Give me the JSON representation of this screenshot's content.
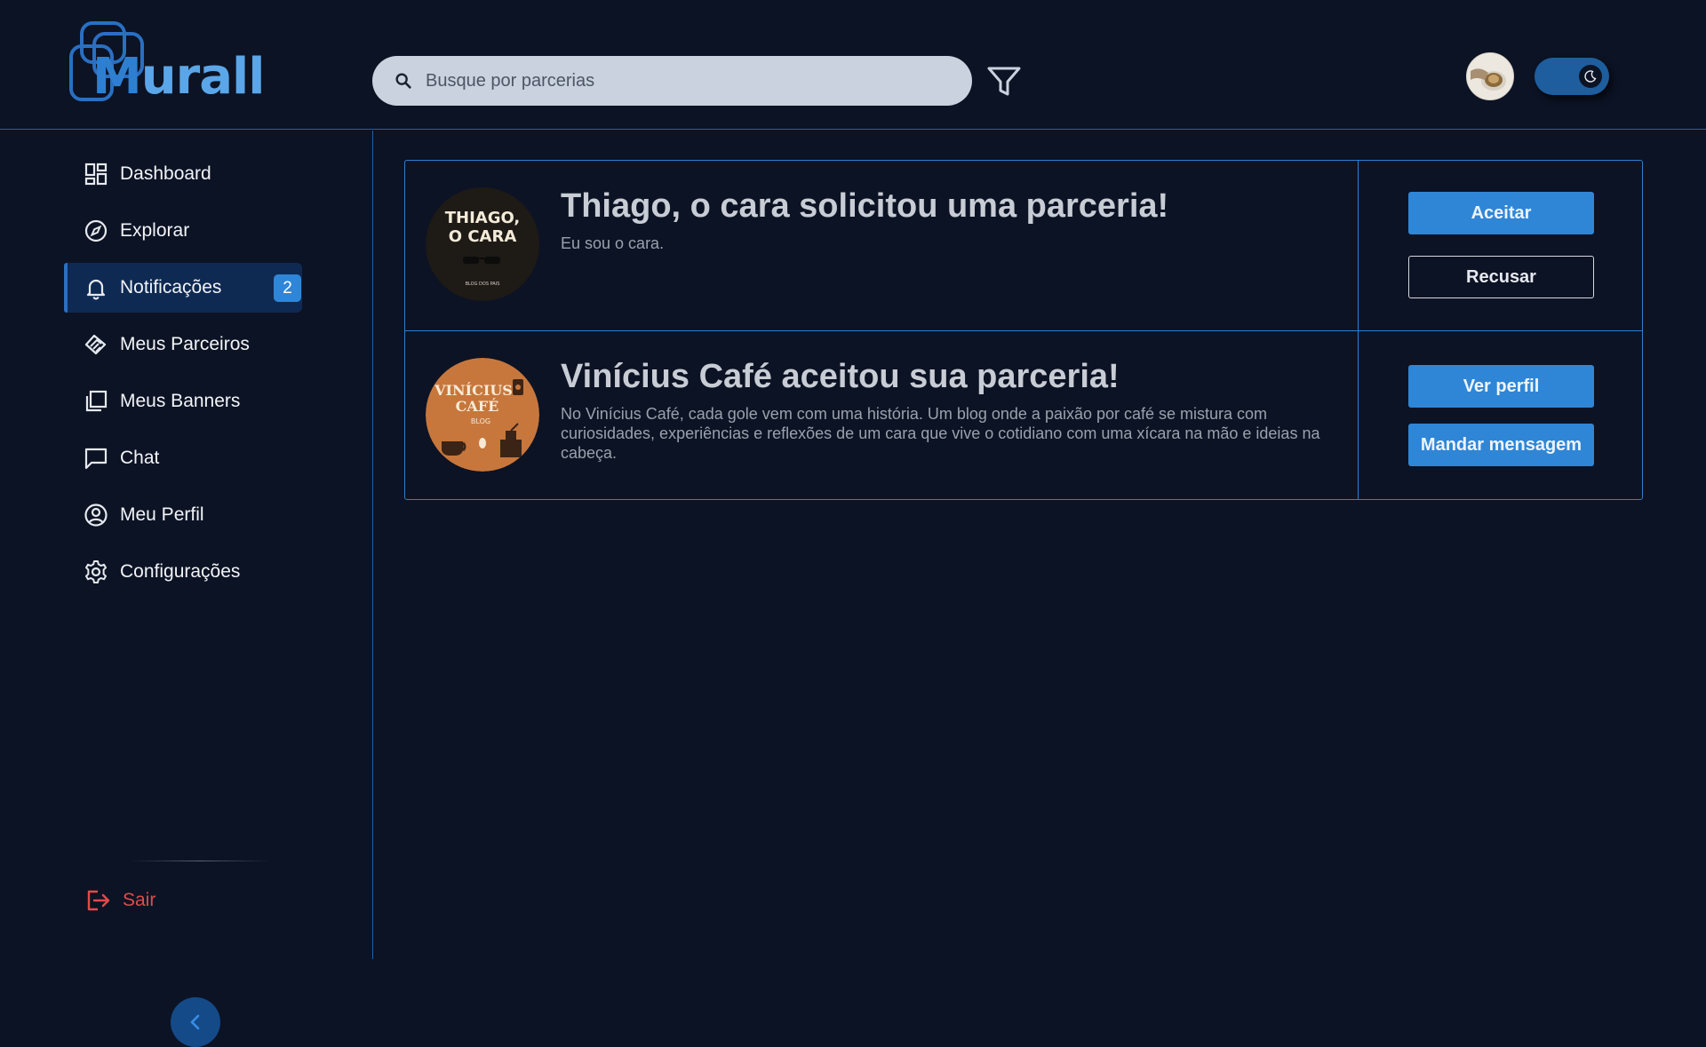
{
  "header": {
    "logo": {
      "text_m": "M",
      "text_rest": "urall"
    },
    "search": {
      "placeholder": "Busque por parcerias"
    },
    "icons": {
      "search": "search-icon",
      "filter": "filter-icon",
      "theme": "moon-icon"
    }
  },
  "sidebar": {
    "items": [
      {
        "label": "Dashboard",
        "icon": "dashboard-icon"
      },
      {
        "label": "Explorar",
        "icon": "compass-icon"
      },
      {
        "label": "Notificações",
        "icon": "bell-icon",
        "badge": "2",
        "active": true
      },
      {
        "label": "Meus Parceiros",
        "icon": "handshake-icon"
      },
      {
        "label": "Meus Banners",
        "icon": "banners-icon"
      },
      {
        "label": "Chat",
        "icon": "chat-icon"
      },
      {
        "label": "Meu Perfil",
        "icon": "user-circle-icon"
      },
      {
        "label": "Configurações",
        "icon": "gear-icon"
      }
    ],
    "logout_label": "Sair"
  },
  "notifications": [
    {
      "title": "Thiago, o cara solicitou uma parceria!",
      "description": "Eu sou o cara.",
      "avatar_text_1": "THIAGO,",
      "avatar_text_2": "O CARA",
      "avatar_text_3": "BLOG DOS PAIS",
      "buttons": [
        "Aceitar",
        "Recusar"
      ]
    },
    {
      "title": "Vinícius Café aceitou sua parceria!",
      "description": "No Vinícius Café, cada gole vem com uma história. Um blog onde a paixão por café se mistura com curiosidades, experiências e reflexões de um cara que vive o cotidiano com uma xícara na mão e ideias na cabeça.",
      "avatar_text_1": "VINÍCIUS",
      "avatar_text_2": "CAFÉ",
      "avatar_text_3": "BLOG",
      "buttons": [
        "Ver perfil",
        "Mandar mensagem"
      ]
    }
  ],
  "colors": {
    "background": "#0c1324",
    "accent": "#2f86d6",
    "border": "#2e7fd0",
    "danger": "#e34a4a"
  }
}
